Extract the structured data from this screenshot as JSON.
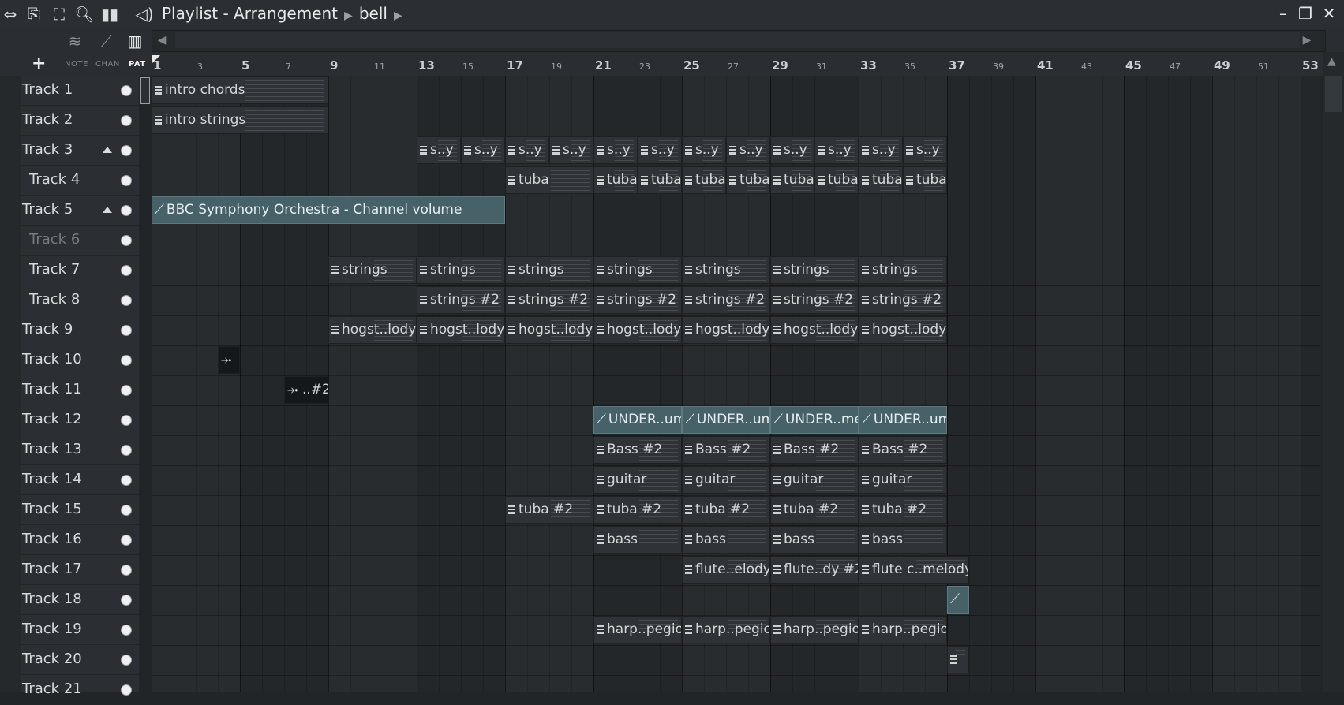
{
  "window": {
    "title": "Playlist - Arrangement",
    "breadcrumb": "bell",
    "controls": {
      "minimize": "–",
      "restore": "❐",
      "close": "✕"
    }
  },
  "toolbar_icons": [
    "arrows-icon",
    "stamp-icon",
    "fullscreen-icon",
    "zoom-icon",
    "audio-bars-icon",
    "speaker-icon"
  ],
  "header": {
    "add_label": "+",
    "mode_labels": {
      "note": "NOTE",
      "chan": "CHAN",
      "pat": "PAT"
    },
    "active_mode": "PAT"
  },
  "ruler": {
    "major": [
      "1",
      "5",
      "9",
      "13",
      "17",
      "21",
      "25",
      "29",
      "33",
      "37",
      "41",
      "45",
      "49",
      "53"
    ],
    "minor": [
      "3",
      "7",
      "11",
      "15",
      "19",
      "23",
      "27",
      "31",
      "35",
      "39",
      "43",
      "47",
      "51"
    ]
  },
  "tracks": [
    {
      "name": "Track 1",
      "indent": false,
      "arrow": false,
      "dim": false
    },
    {
      "name": "Track 2",
      "indent": false,
      "arrow": false,
      "dim": false
    },
    {
      "name": "Track 3",
      "indent": false,
      "arrow": true,
      "dim": false
    },
    {
      "name": "Track 4",
      "indent": true,
      "arrow": false,
      "dim": false
    },
    {
      "name": "Track 5",
      "indent": false,
      "arrow": true,
      "dim": false
    },
    {
      "name": "Track 6",
      "indent": true,
      "arrow": false,
      "dim": true
    },
    {
      "name": "Track 7",
      "indent": true,
      "arrow": false,
      "dim": false
    },
    {
      "name": "Track 8",
      "indent": true,
      "arrow": false,
      "dim": false
    },
    {
      "name": "Track 9",
      "indent": false,
      "arrow": false,
      "dim": false
    },
    {
      "name": "Track 10",
      "indent": false,
      "arrow": false,
      "dim": false
    },
    {
      "name": "Track 11",
      "indent": false,
      "arrow": false,
      "dim": false
    },
    {
      "name": "Track 12",
      "indent": false,
      "arrow": false,
      "dim": false
    },
    {
      "name": "Track 13",
      "indent": false,
      "arrow": false,
      "dim": false
    },
    {
      "name": "Track 14",
      "indent": false,
      "arrow": false,
      "dim": false
    },
    {
      "name": "Track 15",
      "indent": false,
      "arrow": false,
      "dim": false
    },
    {
      "name": "Track 16",
      "indent": false,
      "arrow": false,
      "dim": false
    },
    {
      "name": "Track 17",
      "indent": false,
      "arrow": false,
      "dim": false
    },
    {
      "name": "Track 18",
      "indent": false,
      "arrow": false,
      "dim": false
    },
    {
      "name": "Track 19",
      "indent": false,
      "arrow": false,
      "dim": false
    },
    {
      "name": "Track 20",
      "indent": false,
      "arrow": false,
      "dim": false
    },
    {
      "name": "Track 21",
      "indent": false,
      "arrow": false,
      "dim": false
    }
  ],
  "clips": [
    {
      "track": 1,
      "bar": 1,
      "len": 8,
      "label": "intro chords",
      "kind": "pattern"
    },
    {
      "track": 2,
      "bar": 1,
      "len": 8,
      "label": "intro strings",
      "kind": "pattern"
    },
    {
      "track": 3,
      "bar": 13,
      "len": 2,
      "label": "s..y",
      "kind": "pattern"
    },
    {
      "track": 3,
      "bar": 15,
      "len": 2,
      "label": "s..y",
      "kind": "pattern"
    },
    {
      "track": 3,
      "bar": 17,
      "len": 2,
      "label": "s..y",
      "kind": "pattern"
    },
    {
      "track": 3,
      "bar": 19,
      "len": 2,
      "label": "s..y",
      "kind": "pattern"
    },
    {
      "track": 3,
      "bar": 21,
      "len": 2,
      "label": "s..y",
      "kind": "pattern"
    },
    {
      "track": 3,
      "bar": 23,
      "len": 2,
      "label": "s..y",
      "kind": "pattern"
    },
    {
      "track": 3,
      "bar": 25,
      "len": 2,
      "label": "s..y",
      "kind": "pattern"
    },
    {
      "track": 3,
      "bar": 27,
      "len": 2,
      "label": "s..y",
      "kind": "pattern"
    },
    {
      "track": 3,
      "bar": 29,
      "len": 2,
      "label": "s..y",
      "kind": "pattern"
    },
    {
      "track": 3,
      "bar": 31,
      "len": 2,
      "label": "s..y",
      "kind": "pattern"
    },
    {
      "track": 3,
      "bar": 33,
      "len": 2,
      "label": "s..y",
      "kind": "pattern"
    },
    {
      "track": 3,
      "bar": 35,
      "len": 2,
      "label": "s..y",
      "kind": "pattern"
    },
    {
      "track": 4,
      "bar": 17,
      "len": 4,
      "label": "tuba",
      "kind": "pattern"
    },
    {
      "track": 4,
      "bar": 21,
      "len": 2,
      "label": "tuba",
      "kind": "pattern"
    },
    {
      "track": 4,
      "bar": 23,
      "len": 2,
      "label": "tuba",
      "kind": "pattern"
    },
    {
      "track": 4,
      "bar": 25,
      "len": 2,
      "label": "tuba",
      "kind": "pattern"
    },
    {
      "track": 4,
      "bar": 27,
      "len": 2,
      "label": "tuba",
      "kind": "pattern"
    },
    {
      "track": 4,
      "bar": 29,
      "len": 2,
      "label": "tuba",
      "kind": "pattern"
    },
    {
      "track": 4,
      "bar": 31,
      "len": 2,
      "label": "tuba",
      "kind": "pattern"
    },
    {
      "track": 4,
      "bar": 33,
      "len": 2,
      "label": "tuba",
      "kind": "pattern"
    },
    {
      "track": 4,
      "bar": 35,
      "len": 2,
      "label": "tuba",
      "kind": "pattern"
    },
    {
      "track": 5,
      "bar": 1,
      "len": 16,
      "label": "BBC Symphony Orchestra - Channel volume",
      "kind": "auto"
    },
    {
      "track": 7,
      "bar": 9,
      "len": 4,
      "label": "strings",
      "kind": "pattern"
    },
    {
      "track": 7,
      "bar": 13,
      "len": 4,
      "label": "strings",
      "kind": "pattern"
    },
    {
      "track": 7,
      "bar": 17,
      "len": 4,
      "label": "strings",
      "kind": "pattern"
    },
    {
      "track": 7,
      "bar": 21,
      "len": 4,
      "label": "strings",
      "kind": "pattern"
    },
    {
      "track": 7,
      "bar": 25,
      "len": 4,
      "label": "strings",
      "kind": "pattern"
    },
    {
      "track": 7,
      "bar": 29,
      "len": 4,
      "label": "strings",
      "kind": "pattern"
    },
    {
      "track": 7,
      "bar": 33,
      "len": 4,
      "label": "strings",
      "kind": "pattern"
    },
    {
      "track": 8,
      "bar": 13,
      "len": 4,
      "label": "strings #2",
      "kind": "pattern"
    },
    {
      "track": 8,
      "bar": 17,
      "len": 4,
      "label": "strings #2",
      "kind": "pattern"
    },
    {
      "track": 8,
      "bar": 21,
      "len": 4,
      "label": "strings #2",
      "kind": "pattern"
    },
    {
      "track": 8,
      "bar": 25,
      "len": 4,
      "label": "strings #2",
      "kind": "pattern"
    },
    {
      "track": 8,
      "bar": 29,
      "len": 4,
      "label": "strings #2",
      "kind": "pattern"
    },
    {
      "track": 8,
      "bar": 33,
      "len": 4,
      "label": "strings #2",
      "kind": "pattern"
    },
    {
      "track": 9,
      "bar": 9,
      "len": 4,
      "label": "hogst..lody",
      "kind": "pattern"
    },
    {
      "track": 9,
      "bar": 13,
      "len": 4,
      "label": "hogst..lody",
      "kind": "pattern"
    },
    {
      "track": 9,
      "bar": 17,
      "len": 4,
      "label": "hogst..lody",
      "kind": "pattern"
    },
    {
      "track": 9,
      "bar": 21,
      "len": 4,
      "label": "hogst..lody",
      "kind": "pattern"
    },
    {
      "track": 9,
      "bar": 25,
      "len": 4,
      "label": "hogst..lody",
      "kind": "pattern"
    },
    {
      "track": 9,
      "bar": 29,
      "len": 4,
      "label": "hogst..lody",
      "kind": "pattern"
    },
    {
      "track": 9,
      "bar": 33,
      "len": 4,
      "label": "hogst..lody",
      "kind": "pattern"
    },
    {
      "track": 10,
      "bar": 4,
      "len": 1,
      "label": "⤞",
      "kind": "audio"
    },
    {
      "track": 11,
      "bar": 7,
      "len": 2,
      "label": "⤞ ..#2",
      "kind": "audio"
    },
    {
      "track": 12,
      "bar": 21,
      "len": 4,
      "label": "UNDER..ume",
      "kind": "auto"
    },
    {
      "track": 12,
      "bar": 25,
      "len": 4,
      "label": "UNDER..ume",
      "kind": "auto"
    },
    {
      "track": 12,
      "bar": 29,
      "len": 4,
      "label": "UNDER..me",
      "kind": "auto"
    },
    {
      "track": 12,
      "bar": 33,
      "len": 4,
      "label": "UNDER..ume",
      "kind": "auto"
    },
    {
      "track": 13,
      "bar": 21,
      "len": 4,
      "label": "Bass #2",
      "kind": "pattern"
    },
    {
      "track": 13,
      "bar": 25,
      "len": 4,
      "label": "Bass #2",
      "kind": "pattern"
    },
    {
      "track": 13,
      "bar": 29,
      "len": 4,
      "label": "Bass #2",
      "kind": "pattern"
    },
    {
      "track": 13,
      "bar": 33,
      "len": 4,
      "label": "Bass #2",
      "kind": "pattern"
    },
    {
      "track": 14,
      "bar": 21,
      "len": 4,
      "label": "guitar",
      "kind": "pattern"
    },
    {
      "track": 14,
      "bar": 25,
      "len": 4,
      "label": "guitar",
      "kind": "pattern"
    },
    {
      "track": 14,
      "bar": 29,
      "len": 4,
      "label": "guitar",
      "kind": "pattern"
    },
    {
      "track": 14,
      "bar": 33,
      "len": 4,
      "label": "guitar",
      "kind": "pattern"
    },
    {
      "track": 15,
      "bar": 17,
      "len": 4,
      "label": "tuba #2",
      "kind": "pattern"
    },
    {
      "track": 15,
      "bar": 21,
      "len": 4,
      "label": "tuba #2",
      "kind": "pattern"
    },
    {
      "track": 15,
      "bar": 25,
      "len": 4,
      "label": "tuba #2",
      "kind": "pattern"
    },
    {
      "track": 15,
      "bar": 29,
      "len": 4,
      "label": "tuba #2",
      "kind": "pattern"
    },
    {
      "track": 15,
      "bar": 33,
      "len": 4,
      "label": "tuba #2",
      "kind": "pattern"
    },
    {
      "track": 16,
      "bar": 21,
      "len": 4,
      "label": "bass",
      "kind": "pattern"
    },
    {
      "track": 16,
      "bar": 25,
      "len": 4,
      "label": "bass",
      "kind": "pattern"
    },
    {
      "track": 16,
      "bar": 29,
      "len": 4,
      "label": "bass",
      "kind": "pattern"
    },
    {
      "track": 16,
      "bar": 33,
      "len": 4,
      "label": "bass",
      "kind": "pattern"
    },
    {
      "track": 17,
      "bar": 25,
      "len": 4,
      "label": "flute..elody",
      "kind": "pattern"
    },
    {
      "track": 17,
      "bar": 29,
      "len": 4,
      "label": "flute..dy #2",
      "kind": "pattern"
    },
    {
      "track": 17,
      "bar": 33,
      "len": 5,
      "label": "flute c..melody",
      "kind": "pattern"
    },
    {
      "track": 18,
      "bar": 37,
      "len": 1,
      "label": "",
      "kind": "auto"
    },
    {
      "track": 19,
      "bar": 21,
      "len": 4,
      "label": "harp..pegio",
      "kind": "pattern"
    },
    {
      "track": 19,
      "bar": 25,
      "len": 4,
      "label": "harp..pegio",
      "kind": "pattern"
    },
    {
      "track": 19,
      "bar": 29,
      "len": 4,
      "label": "harp..pegio",
      "kind": "pattern"
    },
    {
      "track": 19,
      "bar": 33,
      "len": 4,
      "label": "harp..pegio",
      "kind": "pattern"
    },
    {
      "track": 20,
      "bar": 37,
      "len": 1,
      "label": "",
      "kind": "pattern"
    }
  ],
  "colors": {
    "accent_auto": "#466168",
    "bg": "#23272a",
    "track_panel": "#2b2f33"
  }
}
